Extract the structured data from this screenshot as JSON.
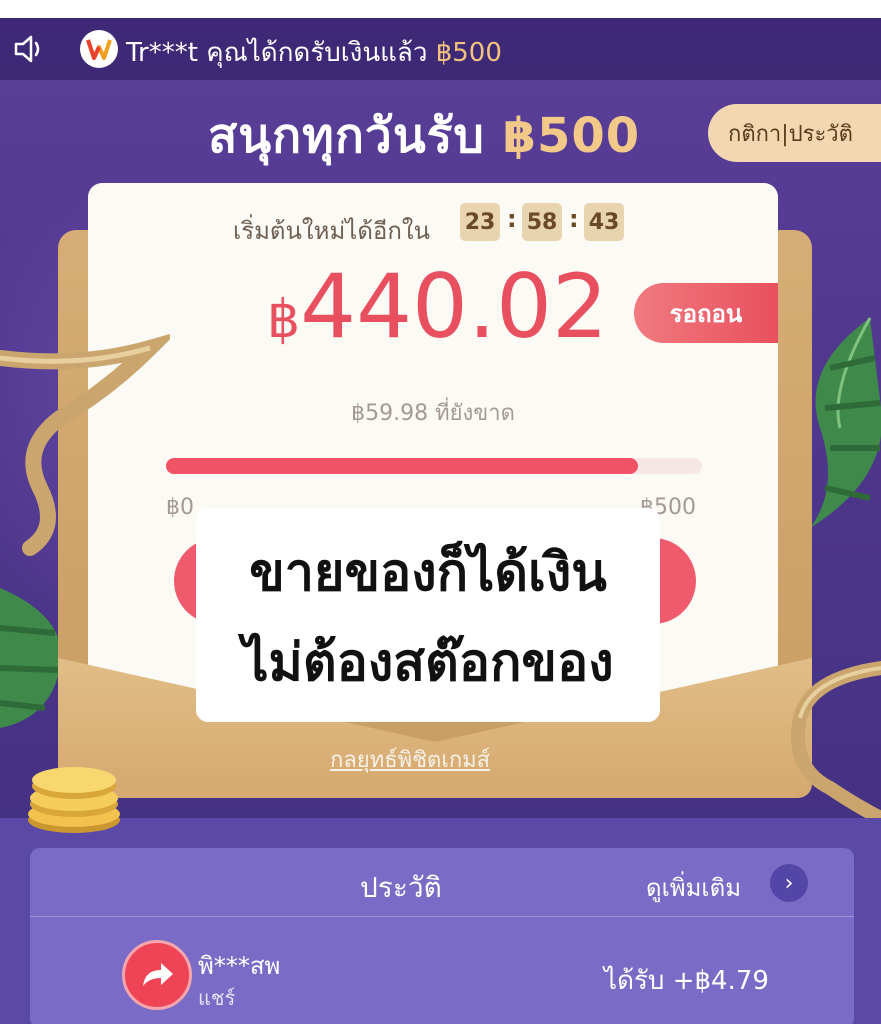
{
  "marquee": {
    "user": "Tr***t",
    "message": " คุณได้กดรับเงินแล้ว ",
    "amount": "฿500"
  },
  "header": {
    "title_prefix": "สนุกทุกวันรับ ",
    "title_amount": "฿500",
    "rules_history_label": "กติกา|ประวัติ"
  },
  "card": {
    "timer_label": "เริ่มต้นใหม่ได้อีกใน",
    "timer": {
      "hours": "23",
      "minutes": "58",
      "seconds": "43",
      "separator": ":"
    },
    "currency_symbol": "฿",
    "amount": "440.02",
    "withdraw_label": "รอถอน",
    "shortfall_text": "฿59.98 ที่ยังขาด",
    "progress": {
      "current": 440.02,
      "max": 500,
      "fraction": 0.88
    },
    "min_label": "฿0",
    "max_label": "฿500"
  },
  "overlay_caption": {
    "line1": "ขายของก็ได้เงิน",
    "line2": "ไม่ต้องสต๊อกของ"
  },
  "strategy_link": "กลยุทธ์พิชิตเกมส์",
  "history": {
    "title": "ประวัติ",
    "more_label": "ดูเพิ่มเติม",
    "entries": [
      {
        "user": "พิ***สพ",
        "action": "แชร์",
        "reward": "ได้รับ +฿4.79"
      }
    ]
  },
  "colors": {
    "background": "#4f378c",
    "accent_red": "#e9505f",
    "gold": "#f3c98a",
    "panel": "#7a6cc6"
  },
  "icons": [
    "speaker-icon",
    "brand-logo-icon",
    "chevron-right-icon",
    "share-icon",
    "coins-icon"
  ]
}
